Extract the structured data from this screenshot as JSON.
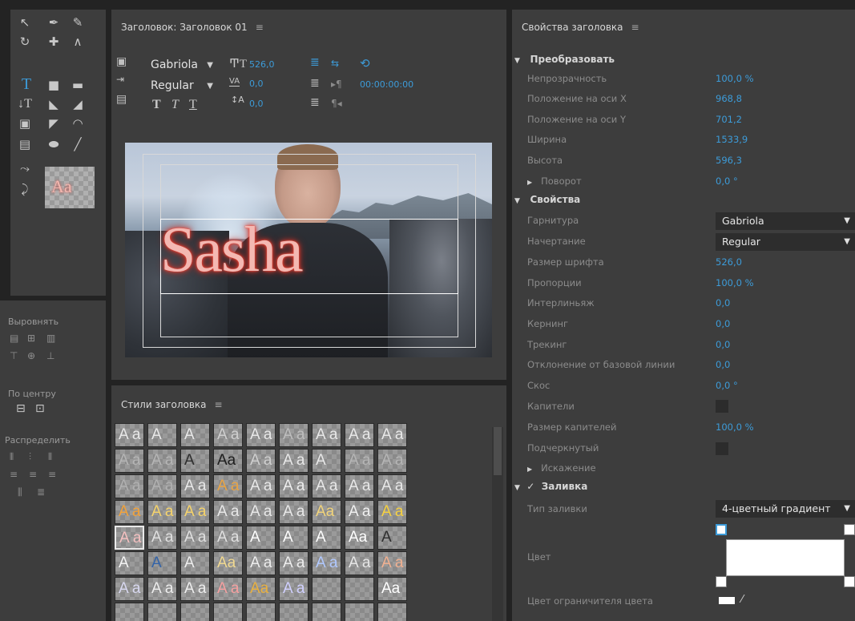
{
  "tools": {
    "names": [
      "selection-tool",
      "pen-tool",
      "delete-anchor-tool",
      "rotation-tool",
      "add-anchor-tool",
      "convert-anchor-tool",
      "type-tool",
      "rectangle-tool",
      "rounded-rectangle-tool",
      "vertical-type-tool",
      "clipped-rectangle-tool",
      "rounded-corner-tool",
      "area-type-tool",
      "wedge-tool",
      "arc-tool",
      "vertical-area-type-tool",
      "ellipse-tool",
      "line-tool",
      "path-type-tool",
      "vertical-path-type-tool"
    ],
    "type_label": "T",
    "vertical_type_label": "↓T",
    "style_preview": "Aa"
  },
  "align": {
    "label": "Выровнять",
    "center_label": "По центру",
    "distribute_label": "Распределить"
  },
  "editor": {
    "title": "Заголовок: Заголовок 01",
    "menu": "≡",
    "font_family": "Gabriola",
    "font_style": "Regular",
    "font_size": "526,0",
    "kerning": "0,0",
    "baseline": "0,0",
    "timecode": "00:00:00:00",
    "bold_label": "T",
    "italic_label": "T",
    "underline_label": "T",
    "overlay_text": "Sasha"
  },
  "styles": {
    "title": "Стили заголовка",
    "menu": "≡",
    "rows": [
      [
        "A a",
        "A",
        "A",
        "A a",
        "A a",
        "A a",
        "A a",
        "A a",
        "A a"
      ],
      [
        "A a",
        "A a",
        "A",
        "Aa",
        "A a",
        "A a",
        "A",
        "A a",
        "A a"
      ],
      [
        "A a",
        "A a",
        "A a",
        "A a",
        "A a",
        "A a",
        "A a",
        "A a",
        "A a"
      ],
      [
        "A a",
        "A a",
        "A a",
        "A a",
        "A a",
        "A a",
        "Aa",
        "A a",
        "A a"
      ],
      [
        "A a",
        "A a",
        "A a",
        "A a",
        "A",
        "A",
        "A",
        "Aa",
        "A"
      ],
      [
        "A",
        "A",
        "A",
        "Aa",
        "A a",
        "A a",
        "A a",
        "A a",
        "A a"
      ],
      [
        "A a",
        "A a",
        "A a",
        "A a",
        "Aa",
        "A a",
        "",
        "",
        "Aa"
      ],
      [
        "",
        "",
        "",
        "",
        "",
        "",
        "",
        "",
        ""
      ]
    ],
    "colors": [
      [
        "#e8e8e8",
        "#e8e8e8",
        "#e8e8e8",
        "#cfcfcf",
        "#e8e8e8",
        "#bdbdbd",
        "#e8e8e8",
        "#e8e8e8",
        "#e8e8e8"
      ],
      [
        "#b5b5b5",
        "#b5b5b5",
        "#2e2e2e",
        "#1e1e1e",
        "#cfcfcf",
        "#e8e8e8",
        "#e8e8e8",
        "#b5b5b5",
        "#b5b5b5"
      ],
      [
        "#b0b0b0",
        "#b0b0b0",
        "#e8e8e8",
        "#e8a445",
        "#e8e8e8",
        "#ededed",
        "#e8e8e8",
        "#e8e8e8",
        "#e8e8e8"
      ],
      [
        "#f2a23a",
        "#f5d36b",
        "#f5d36b",
        "#e8e8e8",
        "#e8e8e8",
        "#e8e8e8",
        "#f0d37a",
        "#f0f0f0",
        "#f5d040"
      ],
      [
        "#f4c0c0",
        "#e0e0e0",
        "#e0e0e0",
        "#e0e0e0",
        "#ffffff",
        "#ffffff",
        "#ffffff",
        "#ffffff",
        "#2e2e2e"
      ],
      [
        "#f4f4f4",
        "#3464a8",
        "#ededed",
        "#f0d890",
        "#ededed",
        "#ededed",
        "#b0c8ff",
        "#e6e6e6",
        "#f0b090"
      ],
      [
        "#d8d8f0",
        "#ededed",
        "#ededed",
        "#f5a0a0",
        "#e8b040",
        "#d0d0ff",
        "#ededed",
        "#ededed",
        "#ffffff"
      ],
      [
        "#ededed",
        "#ededed",
        "#ededed",
        "#ededed",
        "#ededed",
        "#ededed",
        "#ededed",
        "#ededed",
        "#ededed"
      ]
    ]
  },
  "props": {
    "title": "Свойства заголовка",
    "menu": "≡",
    "transform_label": "Преобразовать",
    "opacity_label": "Непрозрачность",
    "opacity": "100,0 %",
    "xpos_label": "Положение на оси X",
    "xpos": "968,8",
    "ypos_label": "Положение на оси Y",
    "ypos": "701,2",
    "width_label": "Ширина",
    "width": "1533,9",
    "height_label": "Высота",
    "height": "596,3",
    "rotation_label": "Поворот",
    "rotation": "0,0 °",
    "properties_label": "Свойства",
    "font_label": "Гарнитура",
    "font": "Gabriola",
    "style_label": "Начертание",
    "style": "Regular",
    "size_label": "Размер шрифта",
    "size": "526,0",
    "aspect_label": "Пропорции",
    "aspect": "100,0 %",
    "leading_label": "Интерлиньяж",
    "leading": "0,0",
    "kerning_label": "Кернинг",
    "kerning": "0,0",
    "tracking_label": "Трекинг",
    "tracking": "0,0",
    "baseline_label": "Отклонение от базовой линии",
    "baseline": "0,0",
    "slant_label": "Скос",
    "slant": "0,0 °",
    "caps_label": "Капители",
    "caps_size_label": "Размер капителей",
    "caps_size": "100,0 %",
    "underline_label": "Подчеркнутый",
    "distort_label": "Искажение",
    "fill_label": "Заливка",
    "fill_type_label": "Тип заливки",
    "fill_type": "4-цветный градиент",
    "color_label": "Цвет",
    "color_stop_label": "Цвет ограничителя цвета"
  }
}
